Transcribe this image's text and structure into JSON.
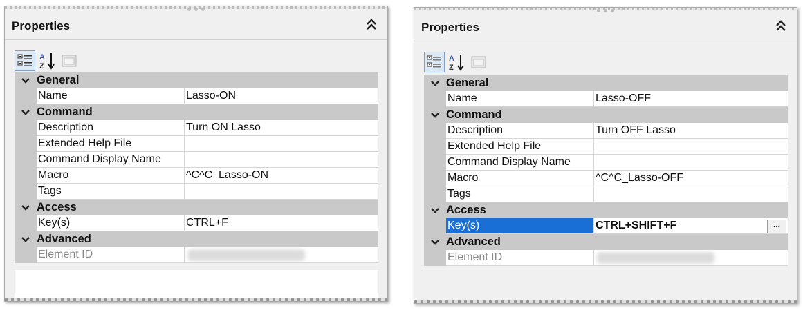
{
  "panels": [
    {
      "title": "Properties",
      "groups": [
        {
          "label": "General",
          "rows": [
            {
              "key": "Name",
              "value": "Lasso-ON"
            }
          ]
        },
        {
          "label": "Command",
          "rows": [
            {
              "key": "Description",
              "value": "Turn ON Lasso"
            },
            {
              "key": "Extended Help File",
              "value": ""
            },
            {
              "key": "Command Display Name",
              "value": ""
            },
            {
              "key": "Macro",
              "value": "^C^C_Lasso-ON"
            },
            {
              "key": "Tags",
              "value": ""
            }
          ]
        },
        {
          "label": "Access",
          "rows": [
            {
              "key": "Key(s)",
              "value": "CTRL+F"
            }
          ]
        },
        {
          "label": "Advanced",
          "rows": [
            {
              "key": "Element ID",
              "value": ""
            }
          ]
        }
      ]
    },
    {
      "title": "Properties",
      "groups": [
        {
          "label": "General",
          "rows": [
            {
              "key": "Name",
              "value": "Lasso-OFF"
            }
          ]
        },
        {
          "label": "Command",
          "rows": [
            {
              "key": "Description",
              "value": "Turn OFF Lasso"
            },
            {
              "key": "Extended Help File",
              "value": ""
            },
            {
              "key": "Command Display Name",
              "value": ""
            },
            {
              "key": "Macro",
              "value": "^C^C_Lasso-OFF"
            },
            {
              "key": "Tags",
              "value": ""
            }
          ]
        },
        {
          "label": "Access",
          "rows": [
            {
              "key": "Key(s)",
              "value": "CTRL+SHIFT+F"
            }
          ]
        },
        {
          "label": "Advanced",
          "rows": [
            {
              "key": "Element ID",
              "value": ""
            }
          ]
        }
      ],
      "ellipsis_label": "..."
    }
  ],
  "colors": {
    "selection": "#1a6fd6",
    "category_bg": "#c9c9c9",
    "panel_bg": "#f0f0f0"
  },
  "icons": [
    "categorized-view-icon",
    "alphabetical-sort-icon",
    "property-pages-icon",
    "collapse-double-chevron-icon",
    "chevron-down-icon"
  ]
}
